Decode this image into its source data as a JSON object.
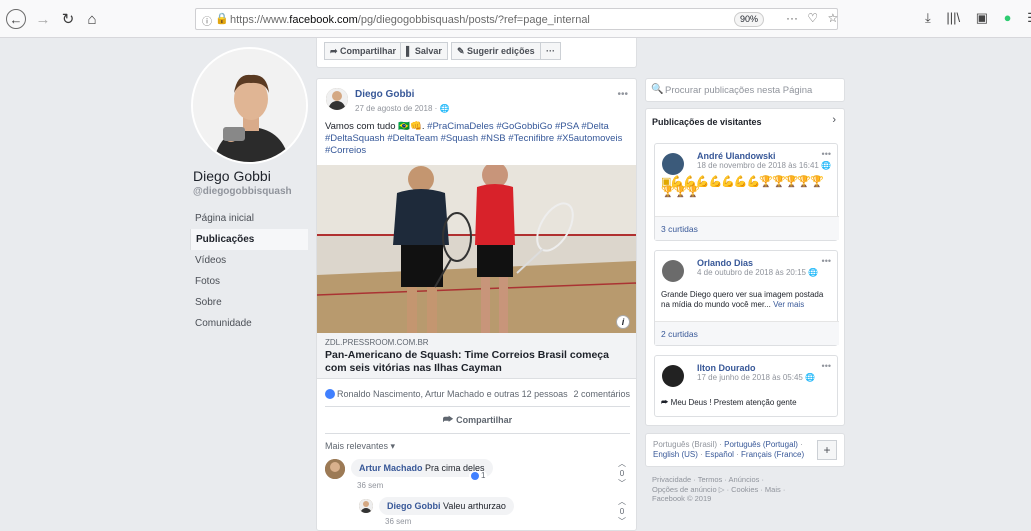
{
  "browser": {
    "url_prefix": "https://www.",
    "url_domain": "facebook.com",
    "url_path": "/pg/diegogobbisquash/posts/?ref=page_internal",
    "zoom": "90%",
    "info_icon": "info-icon",
    "lock_icon": "lock-icon"
  },
  "profile": {
    "name": "Diego Gobbi",
    "handle": "@diegogobbisquash"
  },
  "nav": [
    "Página inicial",
    "Publicações",
    "Vídeos",
    "Fotos",
    "Sobre",
    "Comunidade"
  ],
  "toolbar": {
    "share": "Compartilhar",
    "save": "Salvar",
    "suggest": "Sugerir edições",
    "more": "···"
  },
  "post": {
    "author": "Diego Gobbi",
    "date": "27 de agosto de 2018 · ",
    "text_start": "Vamos com tudo 🇧🇷👊. ",
    "hashtags": "#PraCimaDeles #GoGobbiGo #PSA #Delta #DeltaSquash #DeltaTeam #Squash #NSB #Tecnifibre #X5automoveis #Correios",
    "link_domain": "ZDL.PRESSROOM.COM.BR",
    "link_title": "Pan-Americano de Squash: Time Correios Brasil começa com seis vitórias nas Ilhas Cayman",
    "reactions": "Ronaldo Nascimento, Artur Machado e outras 12 pessoas",
    "comments_count": "2 comentários",
    "share_label": "Compartilhar",
    "relevant": "Mais relevantes ▾",
    "comments": [
      {
        "author": "Artur Machado",
        "text": " Pra cima deles",
        "time": "36 sem",
        "likes": "1",
        "votes": "0"
      },
      {
        "author": "Diego Gobbi",
        "text": " Valeu arthurzao",
        "time": "36 sem",
        "votes": "0"
      }
    ]
  },
  "search": {
    "placeholder": "Procurar publicações nesta Página"
  },
  "visitors": {
    "header": "Publicações de visitantes",
    "posts": [
      {
        "author": "André Ulandowski",
        "date": "18 de novembro de 2018 às 16:41 ",
        "likes": "3 curtidas"
      },
      {
        "author": "Orlando Dias",
        "date": "4 de outubro de 2018 às 20:15 ",
        "text": "Grande Diego quero ver sua imagem postada na mídia do mundo você mer...",
        "more": "Ver mais",
        "likes": "2 curtidas"
      },
      {
        "author": "Ilton Dourado",
        "date": "17 de junho de 2018 às 05:45 ",
        "text": "Meu Deus ! Prestem atenção gente"
      }
    ]
  },
  "languages": {
    "l1": "Português (Brasil)",
    "l2": "Português (Portugal)",
    "l3": "English (US)",
    "l4": "Español",
    "l5": "Français (France)"
  },
  "footer": {
    "line1": "Privacidade · Termos · Anúncios ·",
    "line2": "Opções de anúncio ▷ · Cookies · Mais ·",
    "line3": "Facebook © 2019"
  }
}
